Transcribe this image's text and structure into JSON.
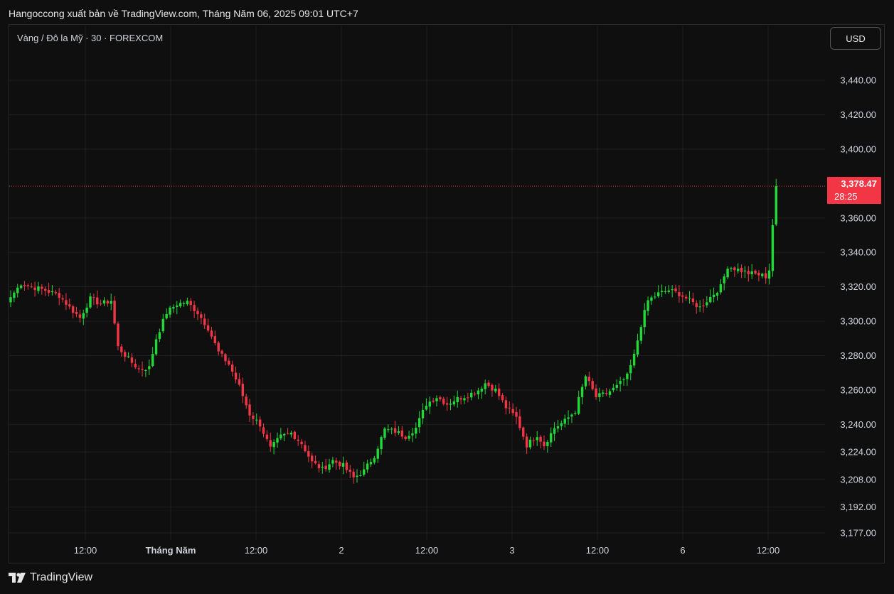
{
  "header": {
    "publisher_line": "Hangoccong xuất bản về TradingView.com, Tháng Năm 06, 2025 09:01 UTC+7"
  },
  "symbol": {
    "title": "Vàng / Đô la Mỹ · 30 · FOREXCOM"
  },
  "currency_button": {
    "label": "USD"
  },
  "brand": {
    "name": "TradingView",
    "icon": "tradingview-logo-icon"
  },
  "price_tag": {
    "price": "3,378.47",
    "countdown": "28:25",
    "color": "#f23645"
  },
  "colors": {
    "up": "#22d938",
    "down": "#f23645",
    "background": "#0f0f0f",
    "grid": "#1f1f1f"
  },
  "chart_data": {
    "type": "candlestick",
    "title": "",
    "xlabel": "",
    "ylabel": "",
    "interval_minutes": 30,
    "ylim": [
      3177,
      3465
    ],
    "y_ticks": [
      "3,440.00",
      "3,420.00",
      "3,400.00",
      "3,360.00",
      "3,340.00",
      "3,320.00",
      "3,300.00",
      "3,280.00",
      "3,260.00",
      "3,240.00",
      "3,224.00",
      "3,208.00",
      "3,192.00",
      "3,177.00"
    ],
    "x_ticks": [
      "12:00",
      "Tháng Năm",
      "12:00",
      "2",
      "12:00",
      "3",
      "12:00",
      "6",
      "12:00"
    ],
    "last_price": 3378.47,
    "grid": true,
    "waypoints": [
      [
        0,
        3314
      ],
      [
        3,
        3322
      ],
      [
        6,
        3320
      ],
      [
        10,
        3318
      ],
      [
        14,
        3315
      ],
      [
        17,
        3308
      ],
      [
        20,
        3302
      ],
      [
        23,
        3313
      ],
      [
        26,
        3310
      ],
      [
        29,
        3312
      ],
      [
        31,
        3285
      ],
      [
        34,
        3278
      ],
      [
        37,
        3272
      ],
      [
        40,
        3273
      ],
      [
        42,
        3290
      ],
      [
        45,
        3305
      ],
      [
        48,
        3310
      ],
      [
        51,
        3311
      ],
      [
        54,
        3305
      ],
      [
        57,
        3296
      ],
      [
        60,
        3282
      ],
      [
        63,
        3275
      ],
      [
        66,
        3262
      ],
      [
        69,
        3246
      ],
      [
        72,
        3240
      ],
      [
        75,
        3226
      ],
      [
        78,
        3233
      ],
      [
        81,
        3235
      ],
      [
        84,
        3229
      ],
      [
        87,
        3218
      ],
      [
        90,
        3214
      ],
      [
        93,
        3219
      ],
      [
        96,
        3216
      ],
      [
        99,
        3209
      ],
      [
        102,
        3213
      ],
      [
        105,
        3222
      ],
      [
        108,
        3237
      ],
      [
        111,
        3236
      ],
      [
        114,
        3233
      ],
      [
        117,
        3238
      ],
      [
        120,
        3252
      ],
      [
        123,
        3256
      ],
      [
        126,
        3252
      ],
      [
        129,
        3255
      ],
      [
        132,
        3257
      ],
      [
        135,
        3260
      ],
      [
        137,
        3264
      ],
      [
        140,
        3260
      ],
      [
        143,
        3250
      ],
      [
        146,
        3244
      ],
      [
        149,
        3228
      ],
      [
        152,
        3234
      ],
      [
        154,
        3228
      ],
      [
        157,
        3238
      ],
      [
        160,
        3242
      ],
      [
        163,
        3248
      ],
      [
        166,
        3268
      ],
      [
        169,
        3256
      ],
      [
        172,
        3258
      ],
      [
        175,
        3262
      ],
      [
        178,
        3268
      ],
      [
        180,
        3280
      ],
      [
        182,
        3298
      ],
      [
        184,
        3312
      ],
      [
        187,
        3316
      ],
      [
        190,
        3318
      ],
      [
        193,
        3316
      ],
      [
        196,
        3312
      ],
      [
        199,
        3308
      ],
      [
        202,
        3314
      ],
      [
        205,
        3320
      ],
      [
        207,
        3332
      ],
      [
        210,
        3330
      ],
      [
        213,
        3328
      ],
      [
        216,
        3327
      ],
      [
        218,
        3326
      ],
      [
        219,
        3330
      ],
      [
        220,
        3356
      ],
      [
        221,
        3378.47
      ]
    ]
  }
}
